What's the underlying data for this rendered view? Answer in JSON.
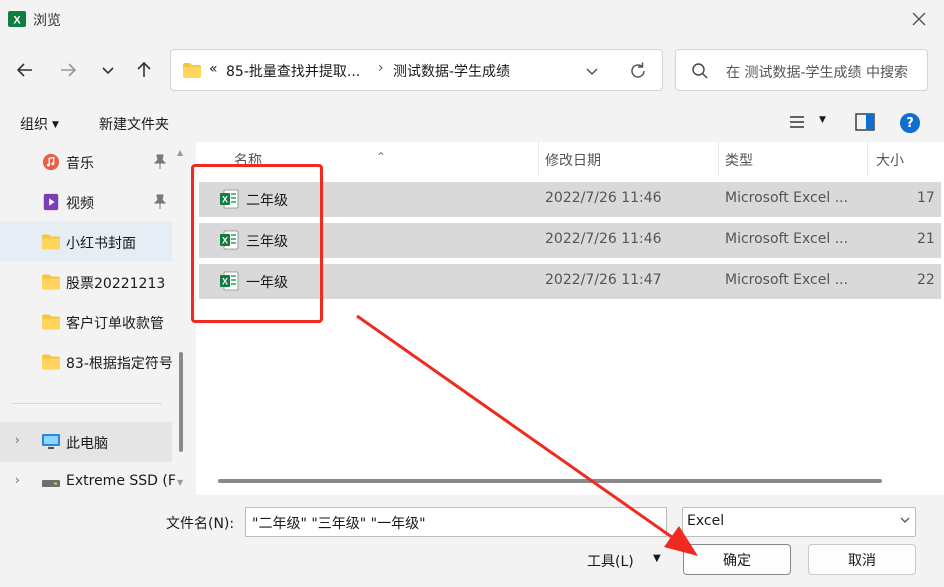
{
  "window": {
    "title": "浏览",
    "icon": "excel-icon"
  },
  "nav": {
    "back_icon": "back-arrow-icon",
    "forward_icon": "forward-arrow-icon",
    "recent_icon": "chevron-down-icon",
    "up_icon": "up-arrow-icon"
  },
  "address": {
    "prefix": "«",
    "segment1": "85-批量查找并提取...",
    "separator": "›",
    "segment2": "测试数据-学生成绩"
  },
  "search": {
    "placeholder": "在 测试数据-学生成绩 中搜索"
  },
  "toolbar": {
    "organize": "组织",
    "new_folder": "新建文件夹"
  },
  "sidebar": {
    "items": [
      {
        "label": "音乐",
        "icon": "music-icon",
        "pinned": true
      },
      {
        "label": "视频",
        "icon": "video-icon",
        "pinned": true
      },
      {
        "label": "小红书封面",
        "icon": "folder-icon"
      },
      {
        "label": "股票20221213",
        "icon": "folder-icon"
      },
      {
        "label": "客户订单收款管",
        "icon": "folder-icon"
      },
      {
        "label": "83-根据指定符号",
        "icon": "folder-icon"
      },
      {
        "label": "此电脑",
        "icon": "computer-icon"
      },
      {
        "label": "Extreme SSD (F",
        "icon": "drive-icon"
      }
    ]
  },
  "columns": {
    "name": "名称",
    "date": "修改日期",
    "type": "类型",
    "size": "大小"
  },
  "files": [
    {
      "name": "二年级",
      "date": "2022/7/26 11:46",
      "type": "Microsoft Excel ...",
      "size": "17"
    },
    {
      "name": "三年级",
      "date": "2022/7/26 11:46",
      "type": "Microsoft Excel ...",
      "size": "21"
    },
    {
      "name": "一年级",
      "date": "2022/7/26 11:47",
      "type": "Microsoft Excel ...",
      "size": "22"
    }
  ],
  "footer": {
    "filename_label": "文件名(N):",
    "filename_value": "\"二年级\" \"三年级\" \"一年级\"",
    "filetype": "Excel",
    "tools": "工具(L)",
    "ok": "确定",
    "cancel": "取消"
  },
  "colors": {
    "annotation": "#f02a20",
    "selection": "#d9d9d9",
    "excel_green": "#107c41",
    "folder_yellow": "#f4c542"
  }
}
